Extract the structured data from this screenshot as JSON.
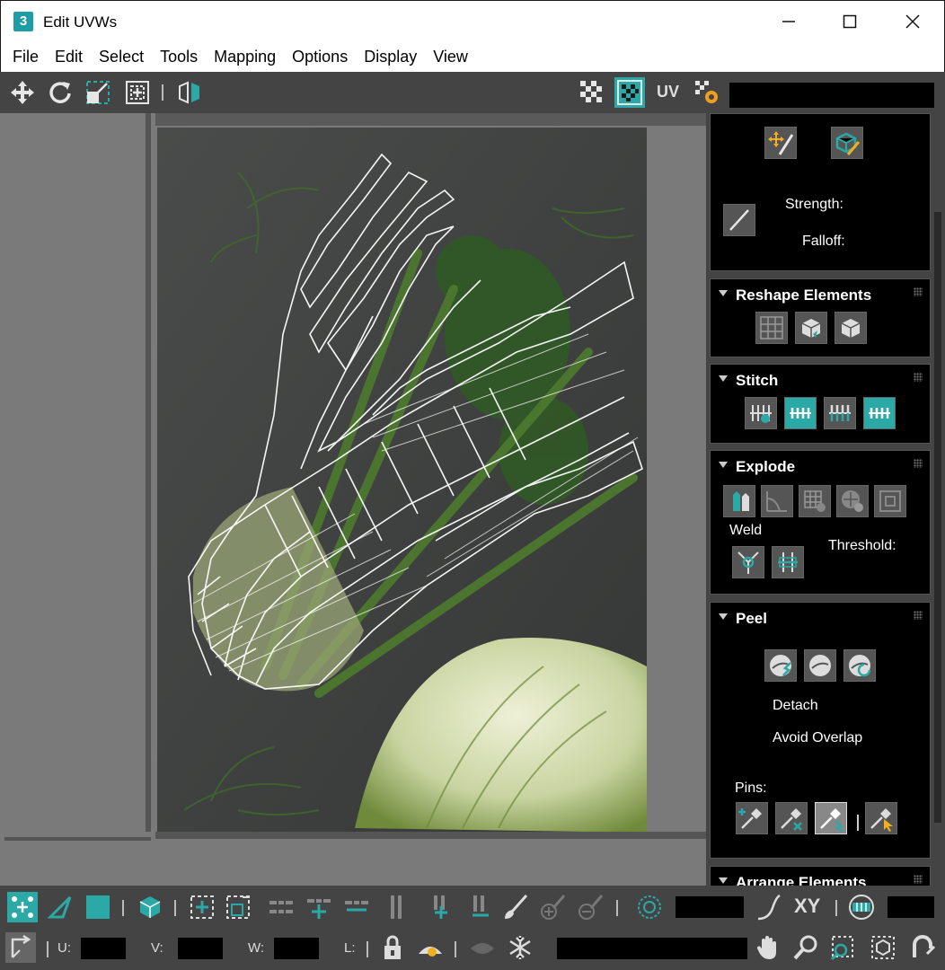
{
  "window": {
    "title": "Edit UVWs",
    "app_icon_text": "3"
  },
  "menu": [
    "File",
    "Edit",
    "Select",
    "Tools",
    "Mapping",
    "Options",
    "Display",
    "View"
  ],
  "toolbar": {
    "tools": [
      "move-icon",
      "rotate-icon",
      "scale-icon",
      "freeform-icon",
      "mirror-icon"
    ],
    "right_tools": [
      "checker-pattern-icon",
      "checker-map-icon",
      "settings-icon"
    ],
    "uv_label": "UV"
  },
  "panel": {
    "strength_label": "Strength:",
    "falloff_label": "Falloff:",
    "reshape": {
      "title": "Reshape Elements"
    },
    "stitch": {
      "title": "Stitch"
    },
    "explode": {
      "title": "Explode",
      "weld_label": "Weld",
      "threshold_label": "Threshold:"
    },
    "peel": {
      "title": "Peel",
      "detach_label": "Detach",
      "avoid_overlap_label": "Avoid Overlap",
      "pins_label": "Pins:"
    },
    "arrange": {
      "title": "Arrange Elements"
    }
  },
  "statusbar": {
    "u_label": "U:",
    "v_label": "V:",
    "w_label": "W:",
    "l_label": "L:",
    "xy_label": "XY"
  },
  "colors": {
    "accent": "#2aa9a6",
    "panel": "#444444",
    "viewport_bg": "#7a7a7a"
  }
}
